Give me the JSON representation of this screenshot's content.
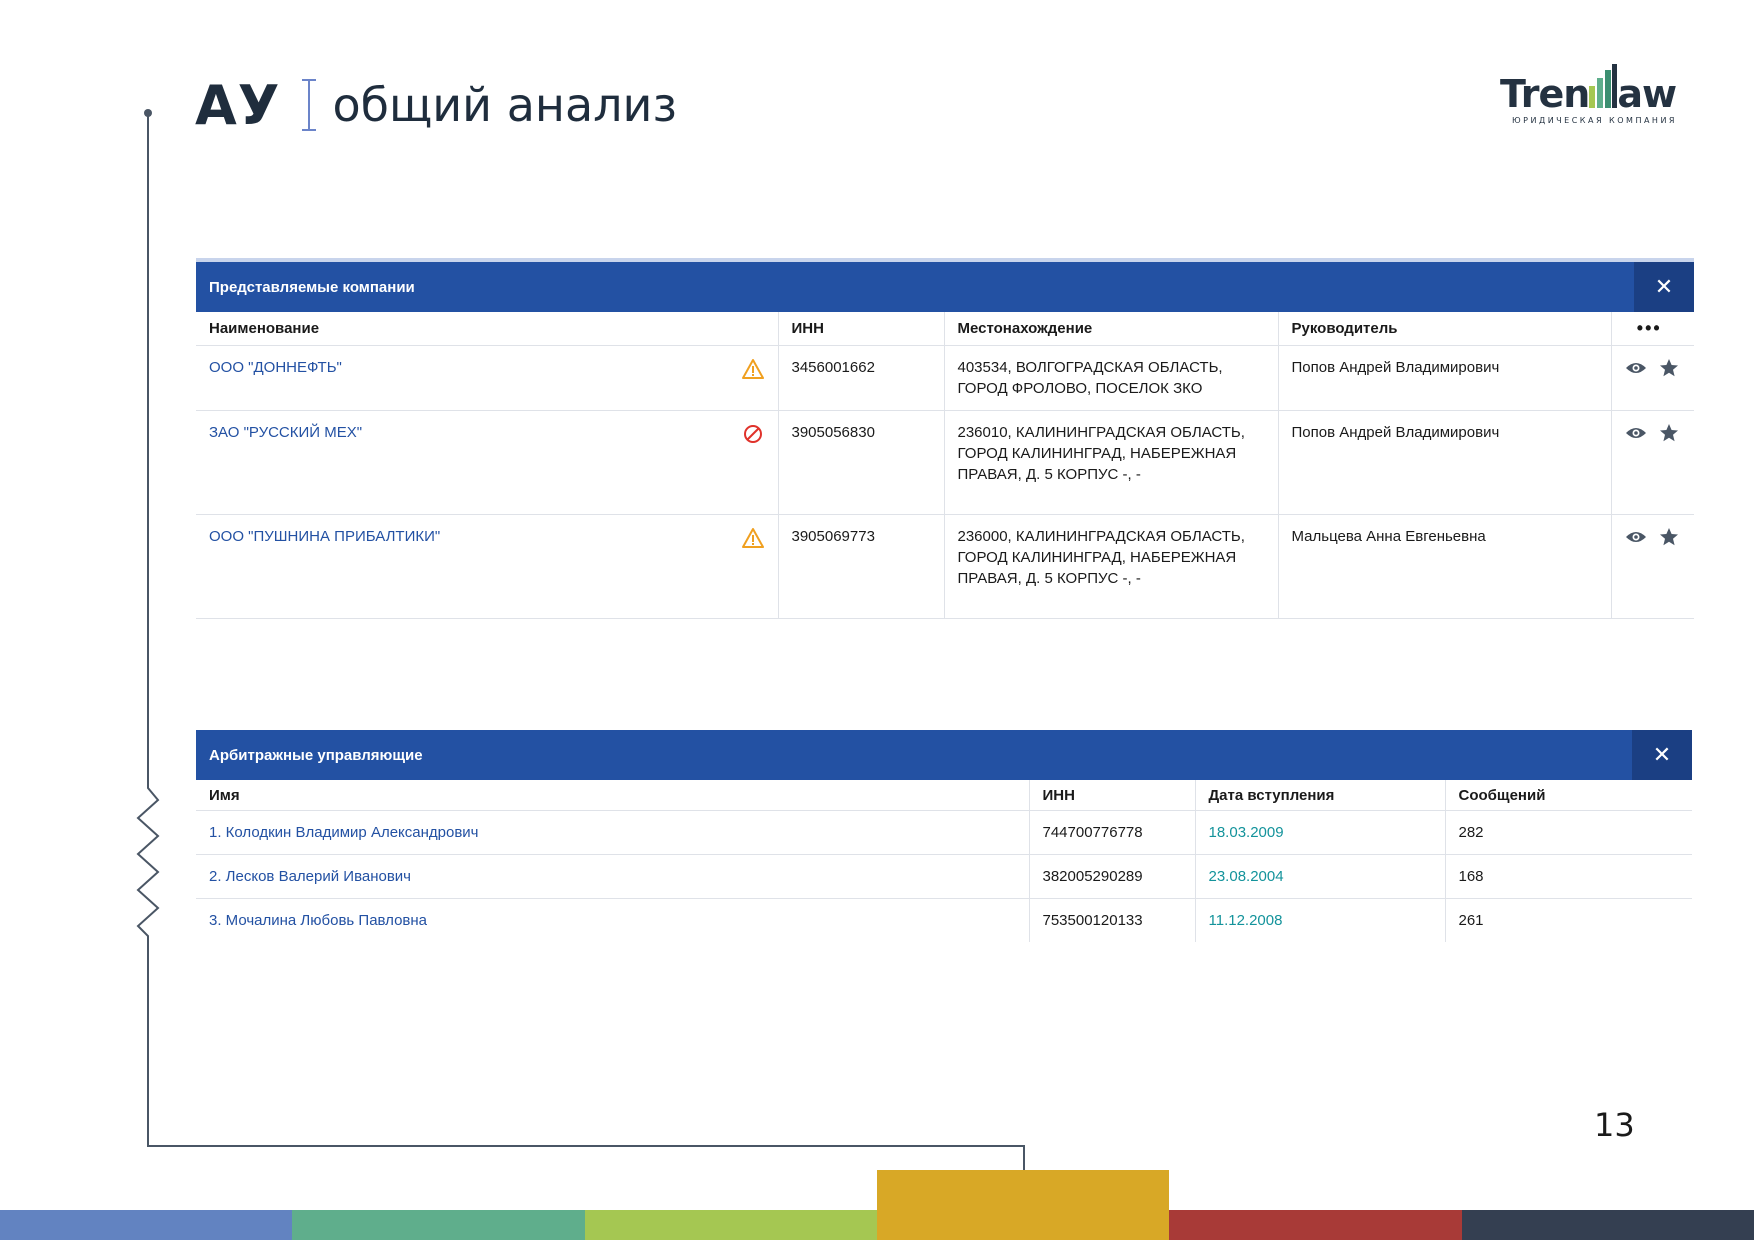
{
  "header": {
    "title_main": "АУ",
    "title_sub": "общий анализ",
    "logo_text": "Trendlaw",
    "logo_subtext": "ЮРИДИЧЕСКАЯ КОМПАНИЯ"
  },
  "companies_panel": {
    "title": "Представляемые компании",
    "close_label": "✕",
    "columns": [
      "Наименование",
      "ИНН",
      "Местонахождение",
      "Руководитель",
      "•••"
    ],
    "rows": [
      {
        "name": "ООО \"ДОННЕФТЬ\"",
        "status": "warning",
        "inn": "3456001662",
        "address": "403534, ВОЛГОГРАДСКАЯ ОБЛАСТЬ, ГОРОД ФРОЛОВО, ПОСЕЛОК ЗКО",
        "head": "Попов Андрей Владимирович"
      },
      {
        "name": "ЗАО \"РУССКИЙ МЕХ\"",
        "status": "blocked",
        "inn": "3905056830",
        "address": "236010, КАЛИНИНГРАДСКАЯ ОБЛАСТЬ, ГОРОД КАЛИНИНГРАД, НАБЕРЕЖНАЯ ПРАВАЯ, Д. 5 КОРПУС -, -",
        "head": "Попов Андрей Владимирович"
      },
      {
        "name": "ООО \"ПУШНИНА ПРИБАЛТИКИ\"",
        "status": "warning",
        "inn": "3905069773",
        "address": "236000, КАЛИНИНГРАДСКАЯ ОБЛАСТЬ, ГОРОД КАЛИНИНГРАД, НАБЕРЕЖНАЯ ПРАВАЯ, Д. 5 КОРПУС -, -",
        "head": "Мальцева Анна Евгеньевна"
      }
    ]
  },
  "managers_panel": {
    "title": "Арбитражные управляющие",
    "close_label": "✕",
    "columns": [
      "Имя",
      "ИНН",
      "Дата вступления",
      "Сообщений"
    ],
    "rows": [
      {
        "name": "1. Колодкин Владимир Александрович",
        "inn": "744700776778",
        "date": "18.03.2009",
        "messages": "282"
      },
      {
        "name": "2. Лесков Валерий Иванович",
        "inn": "382005290289",
        "date": "23.08.2004",
        "messages": "168"
      },
      {
        "name": "3. Мочалина Любовь Павловна",
        "inn": "753500120133",
        "date": "11.12.2008",
        "messages": "261"
      }
    ]
  },
  "page_number": "13",
  "colors": {
    "panel_header": "#2351a3",
    "link": "#2351a3",
    "date": "#13939b",
    "stripes": [
      "#6283c1",
      "#5fae8c",
      "#a5c752",
      "#d8a826",
      "#a83a37",
      "#343f51"
    ]
  }
}
